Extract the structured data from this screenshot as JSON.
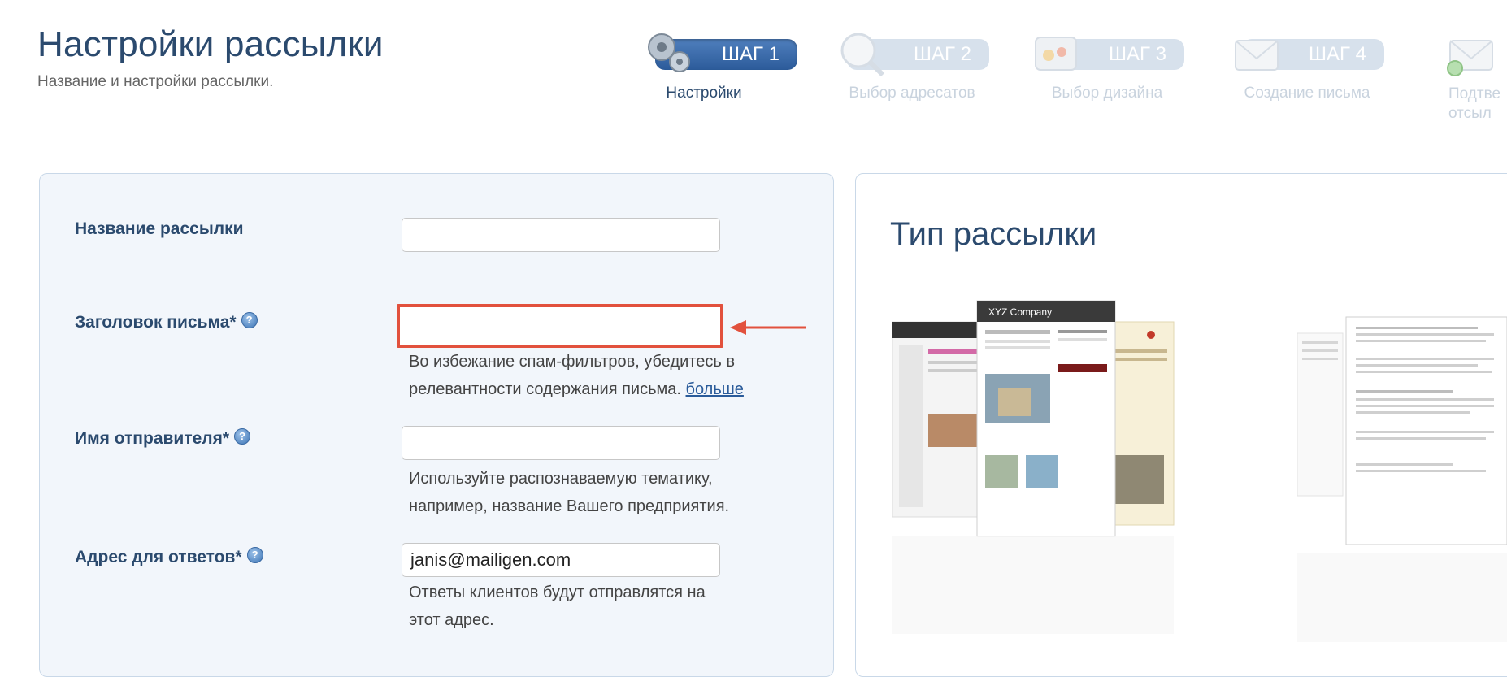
{
  "header": {
    "title": "Настройки рассылки",
    "subtitle": "Название и настройки рассылки."
  },
  "steps": [
    {
      "pill": "ШАГ 1",
      "label": "Настройки",
      "icon": "gears-icon",
      "active": true
    },
    {
      "pill": "ШАГ 2",
      "label": "Выбор адресатов",
      "icon": "magnifier-icon",
      "active": false
    },
    {
      "pill": "ШАГ 3",
      "label": "Выбор дизайна",
      "icon": "palette-icon",
      "active": false
    },
    {
      "pill": "ШАГ 4",
      "label": "Создание письма",
      "icon": "envelope-icon",
      "active": false
    },
    {
      "pill": "",
      "label": "Подтве отсыл",
      "label_line1": "Подтве",
      "label_line2": "отсыл",
      "icon": "send-envelope-icon",
      "active": false
    }
  ],
  "form": {
    "name_label": "Название рассылки",
    "name_value": "",
    "subject_label": "Заголовок письма*",
    "subject_value": "",
    "subject_hint_line1": "Во избежание спам-фильтров, убедитесь в",
    "subject_hint_line2_text": "релевантности содержания письма.",
    "subject_hint_link": "больше",
    "sender_label": "Имя отправителя*",
    "sender_value": "",
    "sender_hint_line1": "Используйте распознаваемую тематику,",
    "sender_hint_line2": "например, название Вашего предприятия.",
    "reply_label": "Адрес для ответов*",
    "reply_value": "janis@mailigen.com",
    "reply_hint_line1": "Ответы клиентов будут отправлятся на",
    "reply_hint_line2": "этот адрес."
  },
  "right_panel": {
    "title": "Тип рассылки",
    "preview_company": "XYZ Company"
  },
  "colors": {
    "accent": "#2c5b9a",
    "title": "#2b4a6e",
    "highlight": "#e2513d",
    "panel_bg": "#f2f6fb"
  }
}
